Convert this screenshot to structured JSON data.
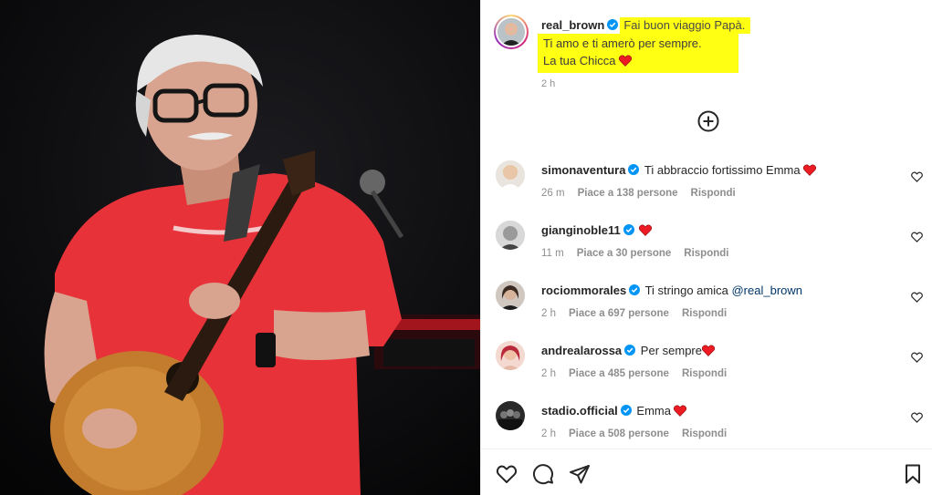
{
  "post": {
    "username": "real_brown",
    "caption_line1": "Fai buon viaggio Papà.",
    "caption_line2": "Ti amo e ti amerò per sempre.",
    "caption_line3": "La tua Chicca",
    "time": "2 h",
    "highlight_color": "#ffff13"
  },
  "comments": [
    {
      "username": "simonaventura",
      "text": "Ti abbraccio fortissimo Emma",
      "time": "26 m",
      "likes": "Piace a 138 persone",
      "reply": "Rispondi"
    },
    {
      "username": "gianginoble11",
      "text": "",
      "time": "11 m",
      "likes": "Piace a 30 persone",
      "reply": "Rispondi"
    },
    {
      "username": "rociommorales",
      "text": "Ti stringo amica ",
      "mention": "@real_brown",
      "time": "2 h",
      "likes": "Piace a 697 persone",
      "reply": "Rispondi"
    },
    {
      "username": "andrealarossa",
      "text": "Per sempre",
      "time": "2 h",
      "likes": "Piace a 485 persone",
      "reply": "Rispondi"
    },
    {
      "username": "stadio.official",
      "text": "Emma",
      "time": "2 h",
      "likes": "Piace a 508 persone",
      "reply": "Rispondi"
    }
  ],
  "icons": {
    "verified_color": "#0095f6",
    "heart_color": "#ed1c24"
  }
}
